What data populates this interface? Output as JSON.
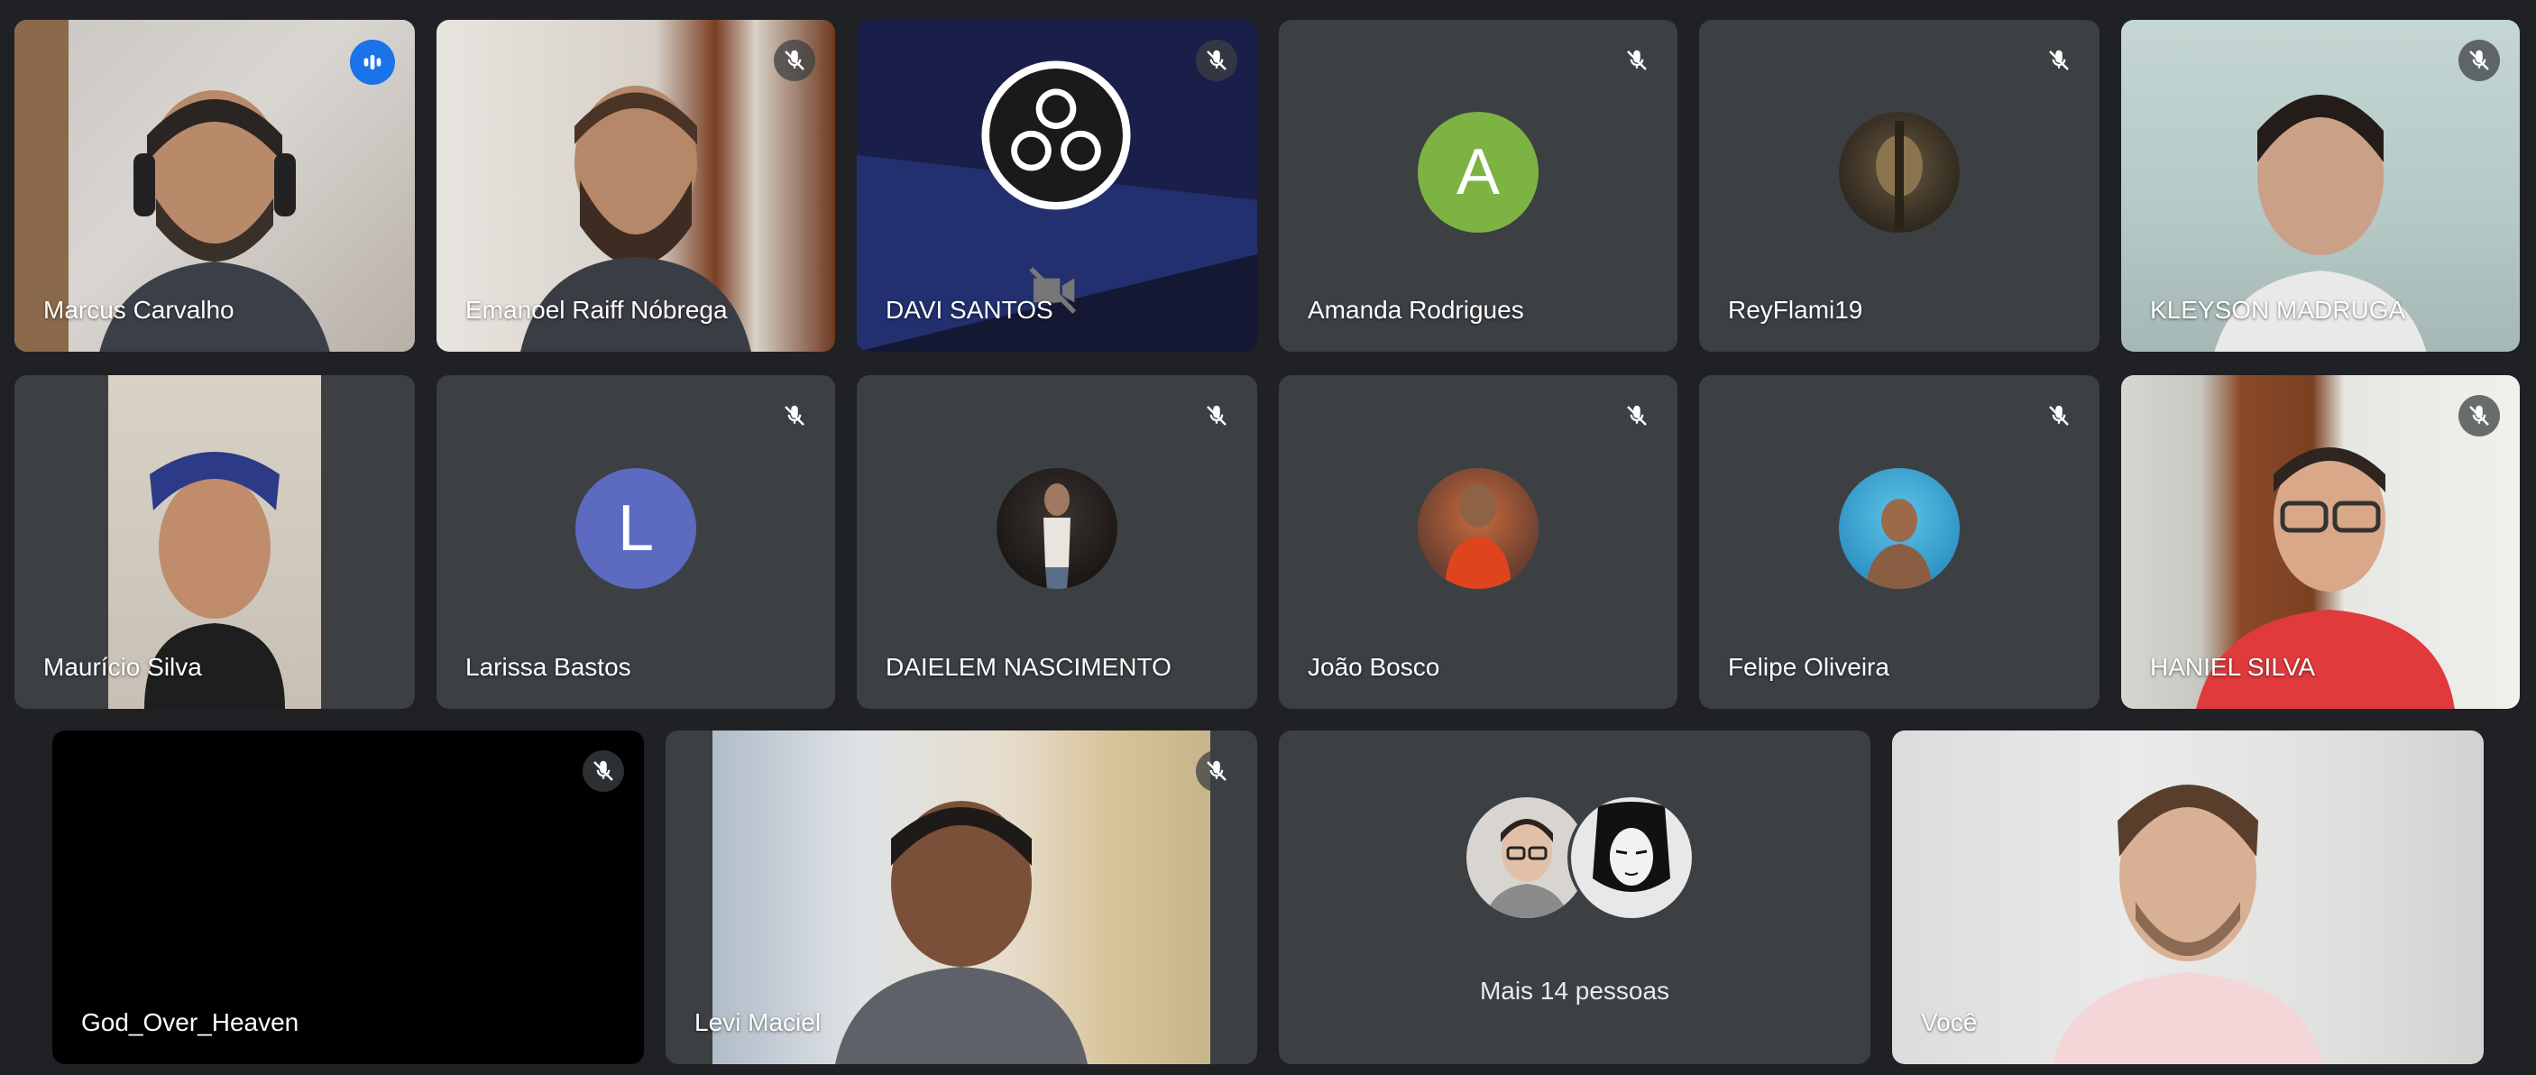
{
  "participants": {
    "t1": {
      "name": "Marcus Carvalho"
    },
    "t2": {
      "name": "Emanoel Raiff Nóbrega"
    },
    "t3": {
      "name": "DAVI SANTOS"
    },
    "t4": {
      "name": "Amanda Rodrigues",
      "initial": "A",
      "avatar_color": "#7cb342"
    },
    "t5": {
      "name": "ReyFlami19"
    },
    "t6": {
      "name": "KLEYSON MADRUGA"
    },
    "t7": {
      "name": "Maurício Silva"
    },
    "t8": {
      "name": "Larissa Bastos",
      "initial": "L",
      "avatar_color": "#5c6bc0"
    },
    "t9": {
      "name": "DAIELEM NASCIMENTO"
    },
    "t10": {
      "name": "João Bosco"
    },
    "t11": {
      "name": "Felipe Oliveira"
    },
    "t12": {
      "name": "HANIEL SILVA"
    },
    "t13": {
      "name": "God_Over_Heaven"
    },
    "t14": {
      "name": "Levi Maciel"
    },
    "more": {
      "label": "Mais 14 pessoas"
    },
    "self": {
      "name": "Você"
    }
  },
  "colors": {
    "background": "#202124",
    "tile": "#3c4043",
    "speaking_border": "#8ab4f8",
    "speaking_indicator": "#1a73e8"
  },
  "icons": {
    "muted": "mic-off-icon",
    "speaking": "audio-level-icon",
    "camera_off": "video-off-icon"
  }
}
